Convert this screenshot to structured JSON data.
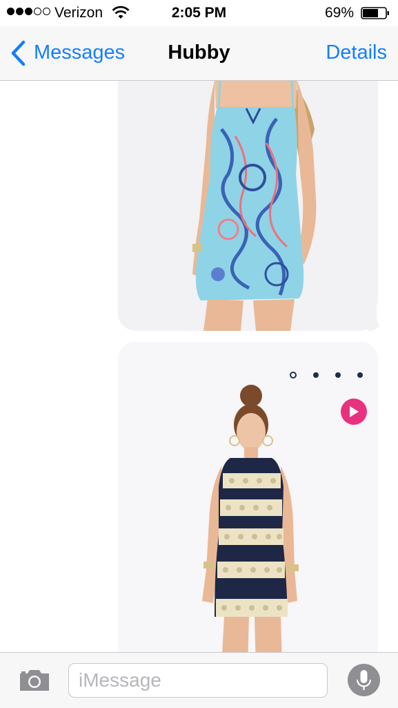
{
  "status_bar": {
    "carrier": "Verizon",
    "signal_bars_filled": 3,
    "signal_bars_total": 5,
    "time": "2:05 PM",
    "battery_percent": "69%",
    "battery_level": 0.69
  },
  "nav": {
    "back_label": "Messages",
    "title": "Hubby",
    "details_label": "Details"
  },
  "thread": {
    "messages": [
      {
        "type": "image",
        "description_icon": "patterned-dress-photo"
      },
      {
        "type": "image",
        "description_icon": "striped-dress-photo",
        "carousel_dots": 4,
        "active_dot": 1
      }
    ]
  },
  "input": {
    "placeholder": "iMessage"
  },
  "colors": {
    "accent": "#147efb",
    "bubble": "#f2f1f3",
    "play_button": "#e8327f"
  }
}
